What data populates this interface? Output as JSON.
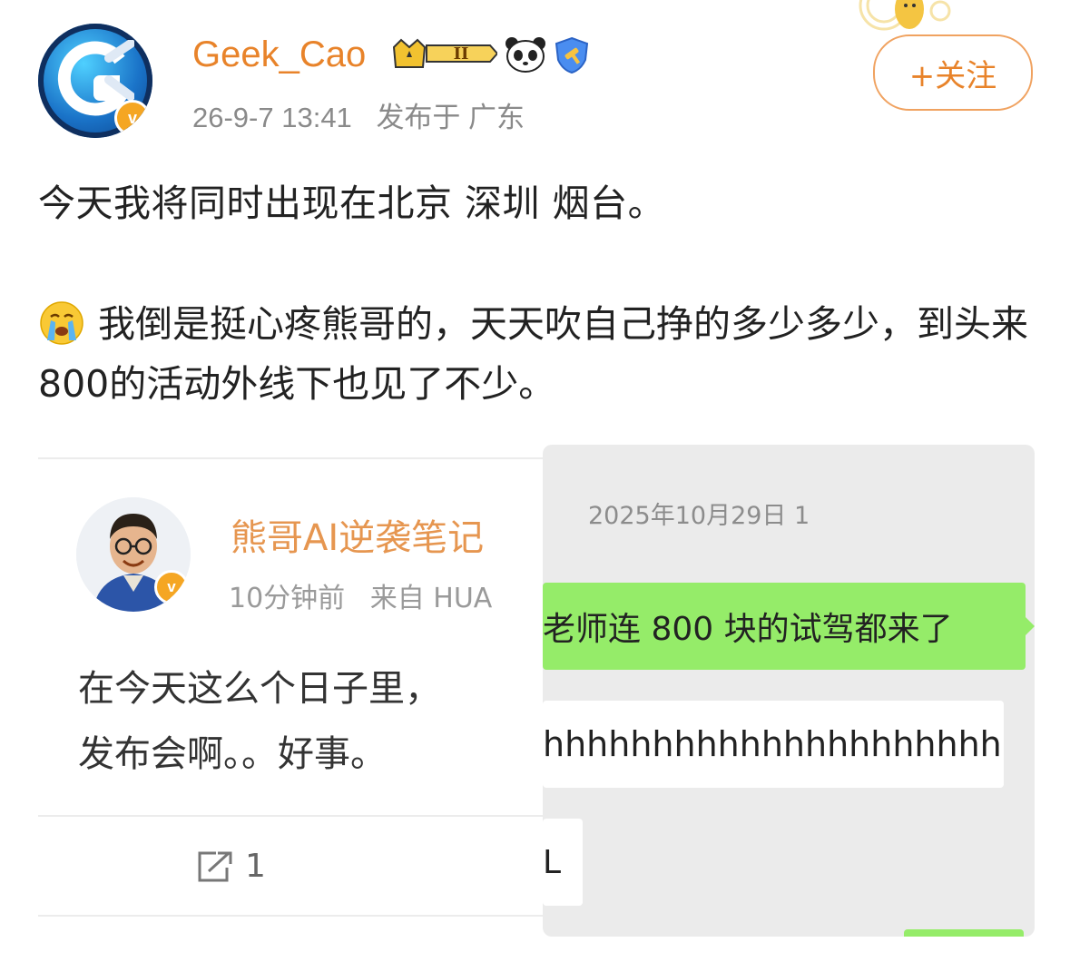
{
  "header": {
    "username": "Geek_Cao",
    "level_badge": "II",
    "timestamp": "26-9-7 13:41",
    "location": "发布于 广东",
    "follow_label": "+关注",
    "verified_mark": "v"
  },
  "post": {
    "line1": "今天我将同时出现在北京 深圳 烟台。",
    "emoji": "crying-face",
    "para2": "我倒是挺心疼熊哥的，天天吹自己挣的多少多少，到头来800的活动外线下也见了不少。"
  },
  "embedded_post": {
    "author": "熊哥AI逆袭笔记",
    "time": "10分钟前",
    "source": "来自 HUA",
    "text_line1": "在今天这么个日子里，",
    "text_line2": "发布会啊。。好事。",
    "share_count": "1",
    "verified_mark": "v"
  },
  "chat_screenshot": {
    "date": "2025年10月29日 1",
    "message_green": "老师连 800 块的试驾都来了",
    "message_white1": "hhhhhhhhhhhhhhhhhhhhhh",
    "message_white2": "L"
  },
  "colors": {
    "username": "#e8832a",
    "follow_border": "#f0a260",
    "verified": "#f5a623",
    "chat_green": "#95ec69",
    "chat_bg": "#ebebeb"
  },
  "icons": [
    "crown-level-badge-icon",
    "panda-icon",
    "shield-icon",
    "verified-icon",
    "crying-face-emoji",
    "share-icon",
    "pikachu-decoration"
  ]
}
